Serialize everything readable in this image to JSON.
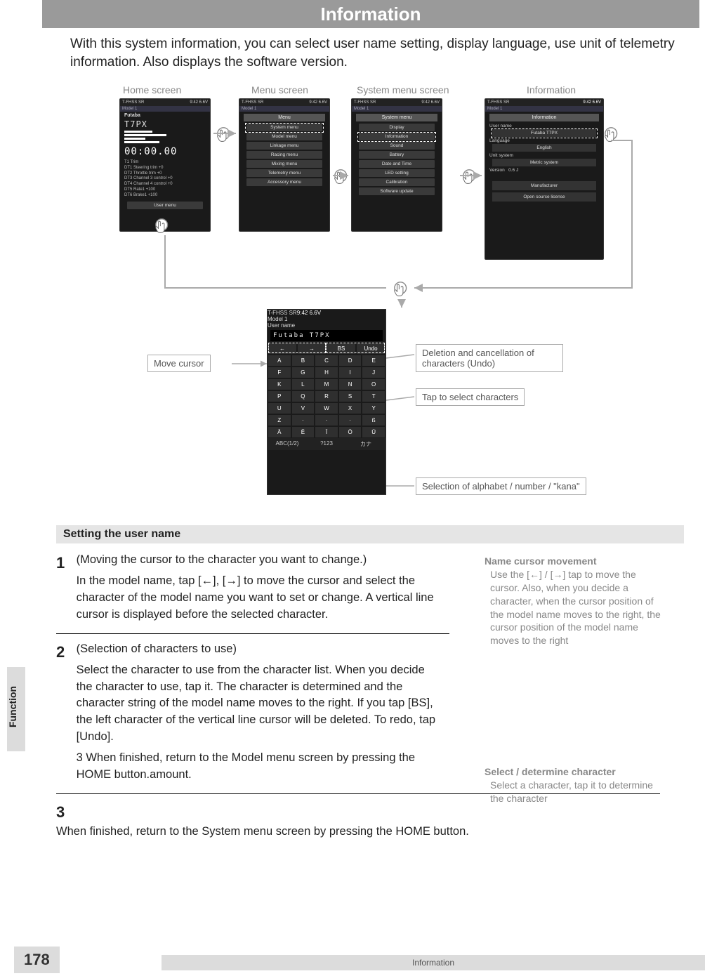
{
  "header": {
    "title": "Information"
  },
  "intro": "With this system information, you can select user name setting, display language, use unit of telemetry information. Also displays the software version.",
  "labels": {
    "home": "Home screen",
    "menu": "Menu screen",
    "system": "System menu screen",
    "info": "Information"
  },
  "home_screen": {
    "topbar_left": "T-FHSS SR",
    "topbar_right": "9:42  6.6V",
    "subtitle": "Model 1",
    "brand": "Futaba",
    "model": "T7PX",
    "timer": "00:00.00",
    "trims": "T1 Trim\nDT1 Steering trim   +0\nDT2 Throttle trim   +0\nDT3 Channel 3 control +0\nDT4 Channel 4 control +0\nDT5 Rate1   +100\nDT6 Brake1  +100",
    "bottom": "User menu"
  },
  "menu_screen": {
    "title": "Menu",
    "items": [
      "System menu",
      "Model menu",
      "Linkage menu",
      "Racing menu",
      "Mixing menu",
      "Telemetry menu",
      "Accessory menu"
    ]
  },
  "system_menu": {
    "title": "System menu",
    "items": [
      "Display",
      "Information",
      "Sound",
      "Battery",
      "Date and Time",
      "LED setting",
      "Calibration",
      "Software update"
    ]
  },
  "info_screen": {
    "title": "Information",
    "user_name_label": "User name",
    "user_name_value": "Futaba T7PX",
    "language_label": "Language",
    "language_value": "English",
    "unit_label": "Unit system",
    "unit_value": "Metric system",
    "version_label": "Version",
    "version_value": "0.6 J",
    "manufacturer_btn": "Manufacturer",
    "license_btn": "Open source license"
  },
  "kb_screen": {
    "title": "User name",
    "input": "Futaba T7PX",
    "top_keys": [
      "←",
      "→",
      "BS",
      "Undo"
    ],
    "rows": [
      [
        "A",
        "B",
        "C",
        "D",
        "E"
      ],
      [
        "F",
        "G",
        "H",
        "I",
        "J"
      ],
      [
        "K",
        "L",
        "M",
        "N",
        "O"
      ],
      [
        "P",
        "Q",
        "R",
        "S",
        "T"
      ],
      [
        "U",
        "V",
        "W",
        "X",
        "Y"
      ],
      [
        "Z",
        "·",
        "·",
        "·",
        "ß"
      ],
      [
        "Ä",
        "Ë",
        "Ï",
        "Ö",
        "Ü"
      ]
    ],
    "bottom": [
      "ABC(1/2)",
      "?123",
      "カナ"
    ]
  },
  "callouts": {
    "move": "Move cursor",
    "undo": "Deletion and cancellation of characters (Undo)",
    "tap": "Tap to select characters",
    "mode": "Selection of alphabet / number / \"kana\""
  },
  "section_title": "Setting the user name",
  "steps": {
    "s1_head": "(Moving the cursor to the character you want to change.)",
    "s1_body": "In the model name, tap [←], [→] to move the cursor and select the character of the model name you want to set or change. A vertical line cursor is displayed before the selected character.",
    "s2_head": "(Selection of characters to use)",
    "s2_body": "Select the character to use from the character list. When you decide the character to use, tap it. The character is determined and the character string of the model name moves to the right. If you tap [BS], the left character of the vertical line cursor will be deleted. To redo, tap [Undo].",
    "s2_extra": "3 When finished, return to the Model menu screen by pressing the HOME button.amount.",
    "s3": "When finished, return to the System menu screen by pressing the HOME button."
  },
  "side": {
    "t1": "Name cursor movement",
    "b1": "Use the [←] / [→] tap to move the cursor. Also, when you decide a character, when the cursor position of the model name moves to the right, the cursor position of the model name moves to the right",
    "t2": "Select / determine character",
    "b2": "Select a character, tap it to determine the character"
  },
  "side_tab": "Function",
  "footer": {
    "label": "Information",
    "page": "178"
  }
}
